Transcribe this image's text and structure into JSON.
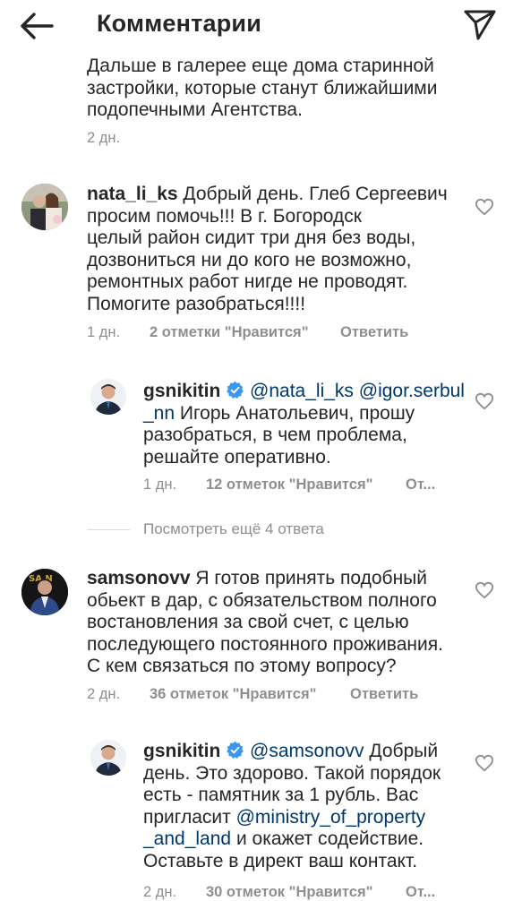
{
  "header": {
    "title": "Комментарии"
  },
  "partial": {
    "line1": "Дальше в галерее еще дома старинной",
    "line2": "застройки, которые станут ближайшими",
    "line3": "подопечными Агентства.",
    "time": "2 дн."
  },
  "comments": [
    {
      "username": "nata_li_ks",
      "line1": "Добрый день. Глеб Сергеевич",
      "line2": "просим помочь!!! В г. Богородск",
      "line3": "целый район сидит три дня без воды,",
      "line4": "дозвониться ни до кого не возможно,",
      "line5": "ремонтных работ нигде не проводят.",
      "line6": "Помогите разобраться!!!!",
      "time": "1 дн.",
      "likes": "2 отметки \"Нравится\"",
      "reply": "Ответить"
    },
    {
      "username": "samsonovv",
      "line1": "Я готов принять подобный",
      "line2": "обьект в дар, с обязательством полного",
      "line3": "востановления за свой счет, с целью",
      "line4": "последующего постоянного проживания.",
      "line5": "С кем связаться по этому вопросу?",
      "time": "2 дн.",
      "likes": "36 отметок \"Нравится\"",
      "reply": "Ответить"
    }
  ],
  "replies": [
    {
      "username": "gsnikitin",
      "mention1": "@nata_li_ks",
      "mention2a": "@igor.serbul",
      "mention2b": "_nn",
      "line2rest": "Игорь Анатольевич, прошу",
      "line3": "разобраться, в чем проблема,",
      "line4": "решайте оперативно.",
      "time": "1 дн.",
      "likes": "12 отметок \"Нравится\"",
      "reply": "От..."
    },
    {
      "username": "gsnikitin",
      "mention1": "@samsonovv",
      "line1rest": "Добрый",
      "line2": "день. Это здорово. Такой порядок",
      "line3": "есть - памятник за 1 рубль. Вас",
      "line4": "пригласит",
      "mention2a": "@ministry_of_property",
      "mention2b": "_and_land",
      "line6rest": "и окажет содействие.",
      "line7": "Оставьте в директ ваш контакт.",
      "time": "2 дн.",
      "likes": "30 отметок \"Нравится\"",
      "reply": "От..."
    }
  ],
  "view_more": "Посмотреть ещё 4 ответа"
}
